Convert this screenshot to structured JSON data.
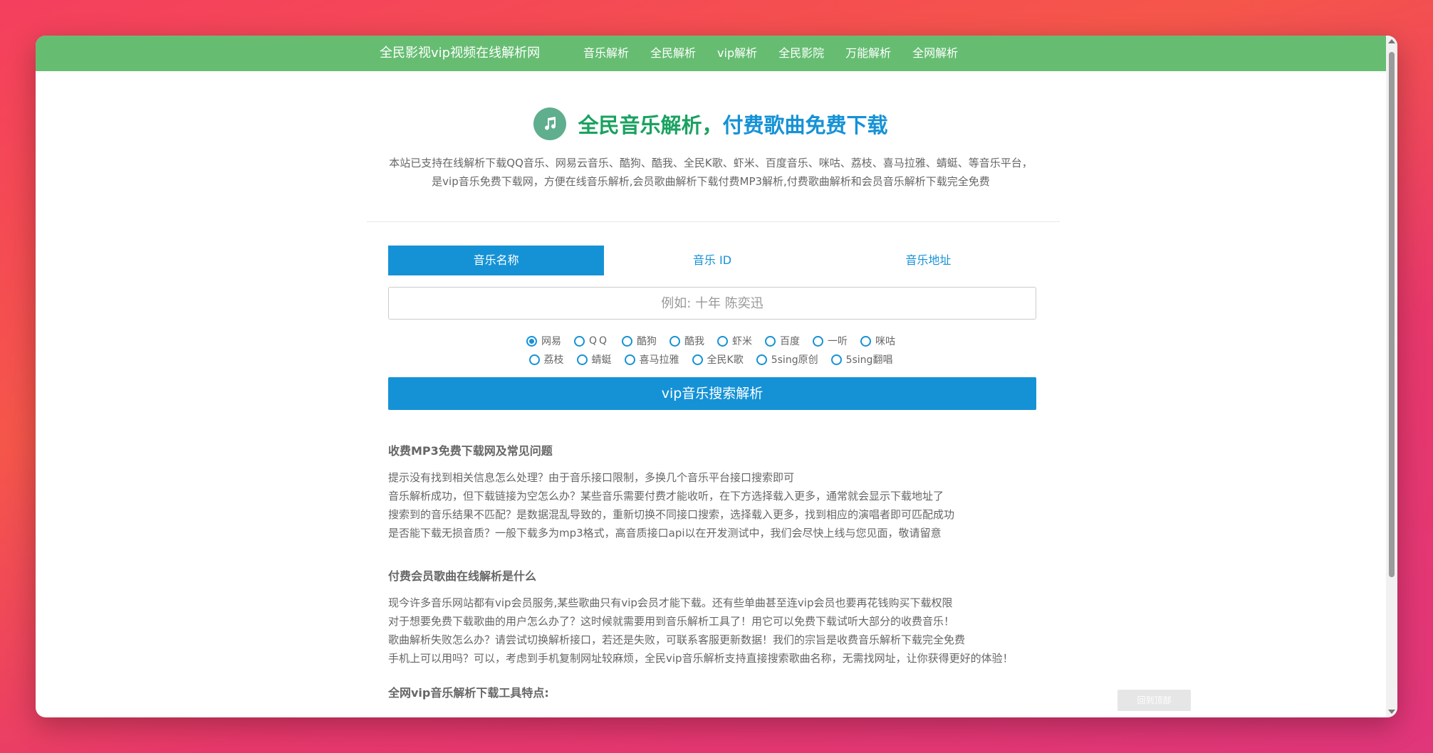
{
  "navbar": {
    "brand": "全民影视vip视频在线解析网",
    "links": [
      "音乐解析",
      "全民解析",
      "vip解析",
      "全民影院",
      "万能解析",
      "全网解析"
    ]
  },
  "header": {
    "icon": "music-note-icon",
    "title_green": "全民音乐解析，",
    "title_blue": "付费歌曲免费下载",
    "desc_line1": "本站已支持在线解析下载QQ音乐、网易云音乐、酷狗、酷我、全民K歌、虾米、百度音乐、咪咕、荔枝、喜马拉雅、蜻蜓、等音乐平台，",
    "desc_line2": "是vip音乐免费下载网，方便在线音乐解析,会员歌曲解析下载付费MP3解析,付费歌曲解析和会员音乐解析下载完全免费"
  },
  "tabs": [
    "音乐名称",
    "音乐 ID",
    "音乐地址"
  ],
  "search": {
    "placeholder": "例如: 十年 陈奕迅"
  },
  "platforms_row1": [
    "网易",
    "QQ",
    "酷狗",
    "酷我",
    "虾米",
    "百度",
    "一听",
    "咪咕"
  ],
  "platforms_row2": [
    "荔枝",
    "蜻蜓",
    "喜马拉雅",
    "全民K歌",
    "5sing原创",
    "5sing翻唱"
  ],
  "selected_platform": "网易",
  "submit_label": "vip音乐搜索解析",
  "faq": {
    "sec1_title": "收费MP3免费下载网及常见问题",
    "sec1_lines": [
      "提示没有找到相关信息怎么处理？由于音乐接口限制，多换几个音乐平台接口搜索即可",
      "音乐解析成功，但下载链接为空怎么办？某些音乐需要付费才能收听，在下方选择载入更多，通常就会显示下载地址了",
      "搜索到的音乐结果不匹配？是数据混乱导致的，重新切换不同接口搜索，选择载入更多，找到相应的演唱者即可匹配成功",
      "是否能下载无损音质？一般下载多为mp3格式，高音质接口api以在开发测试中，我们会尽快上线与您见面，敬请留意"
    ],
    "sec2_title": "付费会员歌曲在线解析是什么",
    "sec2_lines": [
      "现今许多音乐网站都有vip会员服务,某些歌曲只有vip会员才能下载。还有些单曲甚至连vip会员也要再花钱购买下载权限",
      "对于想要免费下载歌曲的用户怎么办了？这时候就需要用到音乐解析工具了！用它可以免费下载试听大部分的收费音乐！",
      "歌曲解析失败怎么办？请尝试切换解析接口，若还是失败，可联系客服更新数据！我们的宗旨是收费音乐解析下载完全免费",
      "手机上可以用吗？可以，考虑到手机复制网址较麻烦，全民vip音乐解析支持直接搜索歌曲名称，无需找网址，让你获得更好的体验！"
    ],
    "sec3_title": "全网vip音乐解析下载工具特点:"
  },
  "back_to_top": "回到顶部"
}
